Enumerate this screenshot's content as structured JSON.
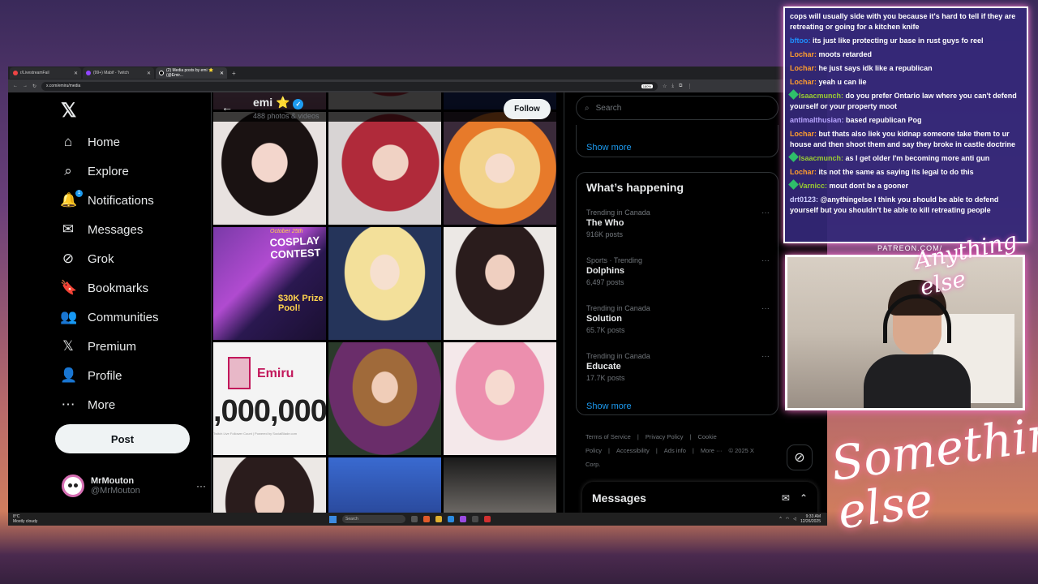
{
  "browser": {
    "tabs": [
      {
        "label": "r/LivestreamFail",
        "active": false
      },
      {
        "label": "(99+) Mabif - Twitch",
        "active": false
      },
      {
        "label": "(2) Media posts by emi ⭐ (@Emir...",
        "active": true
      }
    ],
    "url": "x.com/emiru/media",
    "zoom": "180%"
  },
  "nav": {
    "items": [
      {
        "label": "Home",
        "icon": "home-icon",
        "glyph": "⌂"
      },
      {
        "label": "Explore",
        "icon": "search-icon",
        "glyph": "⌕"
      },
      {
        "label": "Notifications",
        "icon": "bell-icon",
        "glyph": "🔔",
        "badge": "1"
      },
      {
        "label": "Messages",
        "icon": "mail-icon",
        "glyph": "✉"
      },
      {
        "label": "Grok",
        "icon": "grok-icon",
        "glyph": "⊘"
      },
      {
        "label": "Bookmarks",
        "icon": "bookmark-icon",
        "glyph": "🔖"
      },
      {
        "label": "Communities",
        "icon": "people-icon",
        "glyph": "👥"
      },
      {
        "label": "Premium",
        "icon": "x-icon",
        "glyph": "𝕏"
      },
      {
        "label": "Profile",
        "icon": "person-icon",
        "glyph": "👤"
      },
      {
        "label": "More",
        "icon": "more-circle-icon",
        "glyph": "⋯"
      }
    ],
    "post_label": "Post",
    "account": {
      "name": "MrMouton",
      "handle": "@MrMouton"
    }
  },
  "profile": {
    "name": "emi",
    "star": "⭐",
    "verified": "✓",
    "count": "488 photos & videos",
    "follow_label": "Follow"
  },
  "media": {
    "promo": {
      "date": "October 25th",
      "title": "COSPLAY CONTEST",
      "prize": "$30K Prize Pool!"
    },
    "counter": {
      "name": "Emiru",
      "number": ",000,000",
      "footer": "Twitch Live Follower Count | Powered by SocialBlade.com"
    }
  },
  "right": {
    "search_placeholder": "Search",
    "show_more": "Show more",
    "whats_happening": "What’s happening",
    "trends": [
      {
        "context": "Trending in Canada",
        "name": "The Who",
        "count": "916K posts"
      },
      {
        "context": "Sports · Trending",
        "name": "Dolphins",
        "count": "6,497 posts"
      },
      {
        "context": "Trending in Canada",
        "name": "Solution",
        "count": "65.7K posts"
      },
      {
        "context": "Trending in Canada",
        "name": "Educate",
        "count": "17.7K posts"
      }
    ],
    "footer": [
      "Terms of Service",
      "|",
      "Privacy Policy",
      "|",
      "Cookie Policy",
      "|",
      "Accessibility",
      "|",
      "Ads info",
      "|",
      "More ···",
      "© 2025 X Corp."
    ],
    "messages_title": "Messages"
  },
  "taskbar": {
    "weather_temp": "8°C",
    "weather_desc": "Mostly cloudy",
    "search": "Search",
    "time": "9:33 AM",
    "date": "12/26/2025"
  },
  "chat": [
    {
      "user": "",
      "text": "cops will usually side with you because it's hard to tell if they are retreating or going for a kitchen knife",
      "color": "#ffffff",
      "badge": false
    },
    {
      "user": "bftoo:",
      "text": "its just like protecting ur base in rust guys fo reel",
      "color": "#1e90ff",
      "badge": false
    },
    {
      "user": "Lochar:",
      "text": "moots retarded",
      "color": "#ff9d2e",
      "badge": false
    },
    {
      "user": "Lochar:",
      "text": "he just says idk like a republican",
      "color": "#ff9d2e",
      "badge": false
    },
    {
      "user": "Lochar:",
      "text": "yeah u can lie",
      "color": "#ff9d2e",
      "badge": false
    },
    {
      "user": "Isaacmunch:",
      "text": "do you prefer Ontario law where you can't defend yourself or your property moot",
      "color": "#9acd32",
      "badge": true
    },
    {
      "user": "antimalthusian:",
      "text": "based republican Pog",
      "color": "#b8a5ff",
      "badge": false
    },
    {
      "user": "Lochar:",
      "text": "but thats also liek you kidnap someone take them to ur house and then shoot them and say they broke in castle doctrine",
      "color": "#ff9d2e",
      "badge": false
    },
    {
      "user": "Isaacmunch:",
      "text": "as I get older I'm becoming more anti gun",
      "color": "#9acd32",
      "badge": true
    },
    {
      "user": "Lochar:",
      "text": "its not the same as saying its legal to do this",
      "color": "#ff9d2e",
      "badge": false
    },
    {
      "user": "Varnicc:",
      "text": "mout dont be a gooner",
      "color": "#9acd32",
      "badge": true
    },
    {
      "user": "drt0123:",
      "text": "@anythingelse I think you should be able to defend yourself but you shouldn't be able to kill retreating people",
      "color": "#cfcfff",
      "badge": false
    }
  ],
  "overlay": {
    "patreon": "PATREON.COM/",
    "signature_small": "Anything else",
    "signature_big": "Something else"
  }
}
